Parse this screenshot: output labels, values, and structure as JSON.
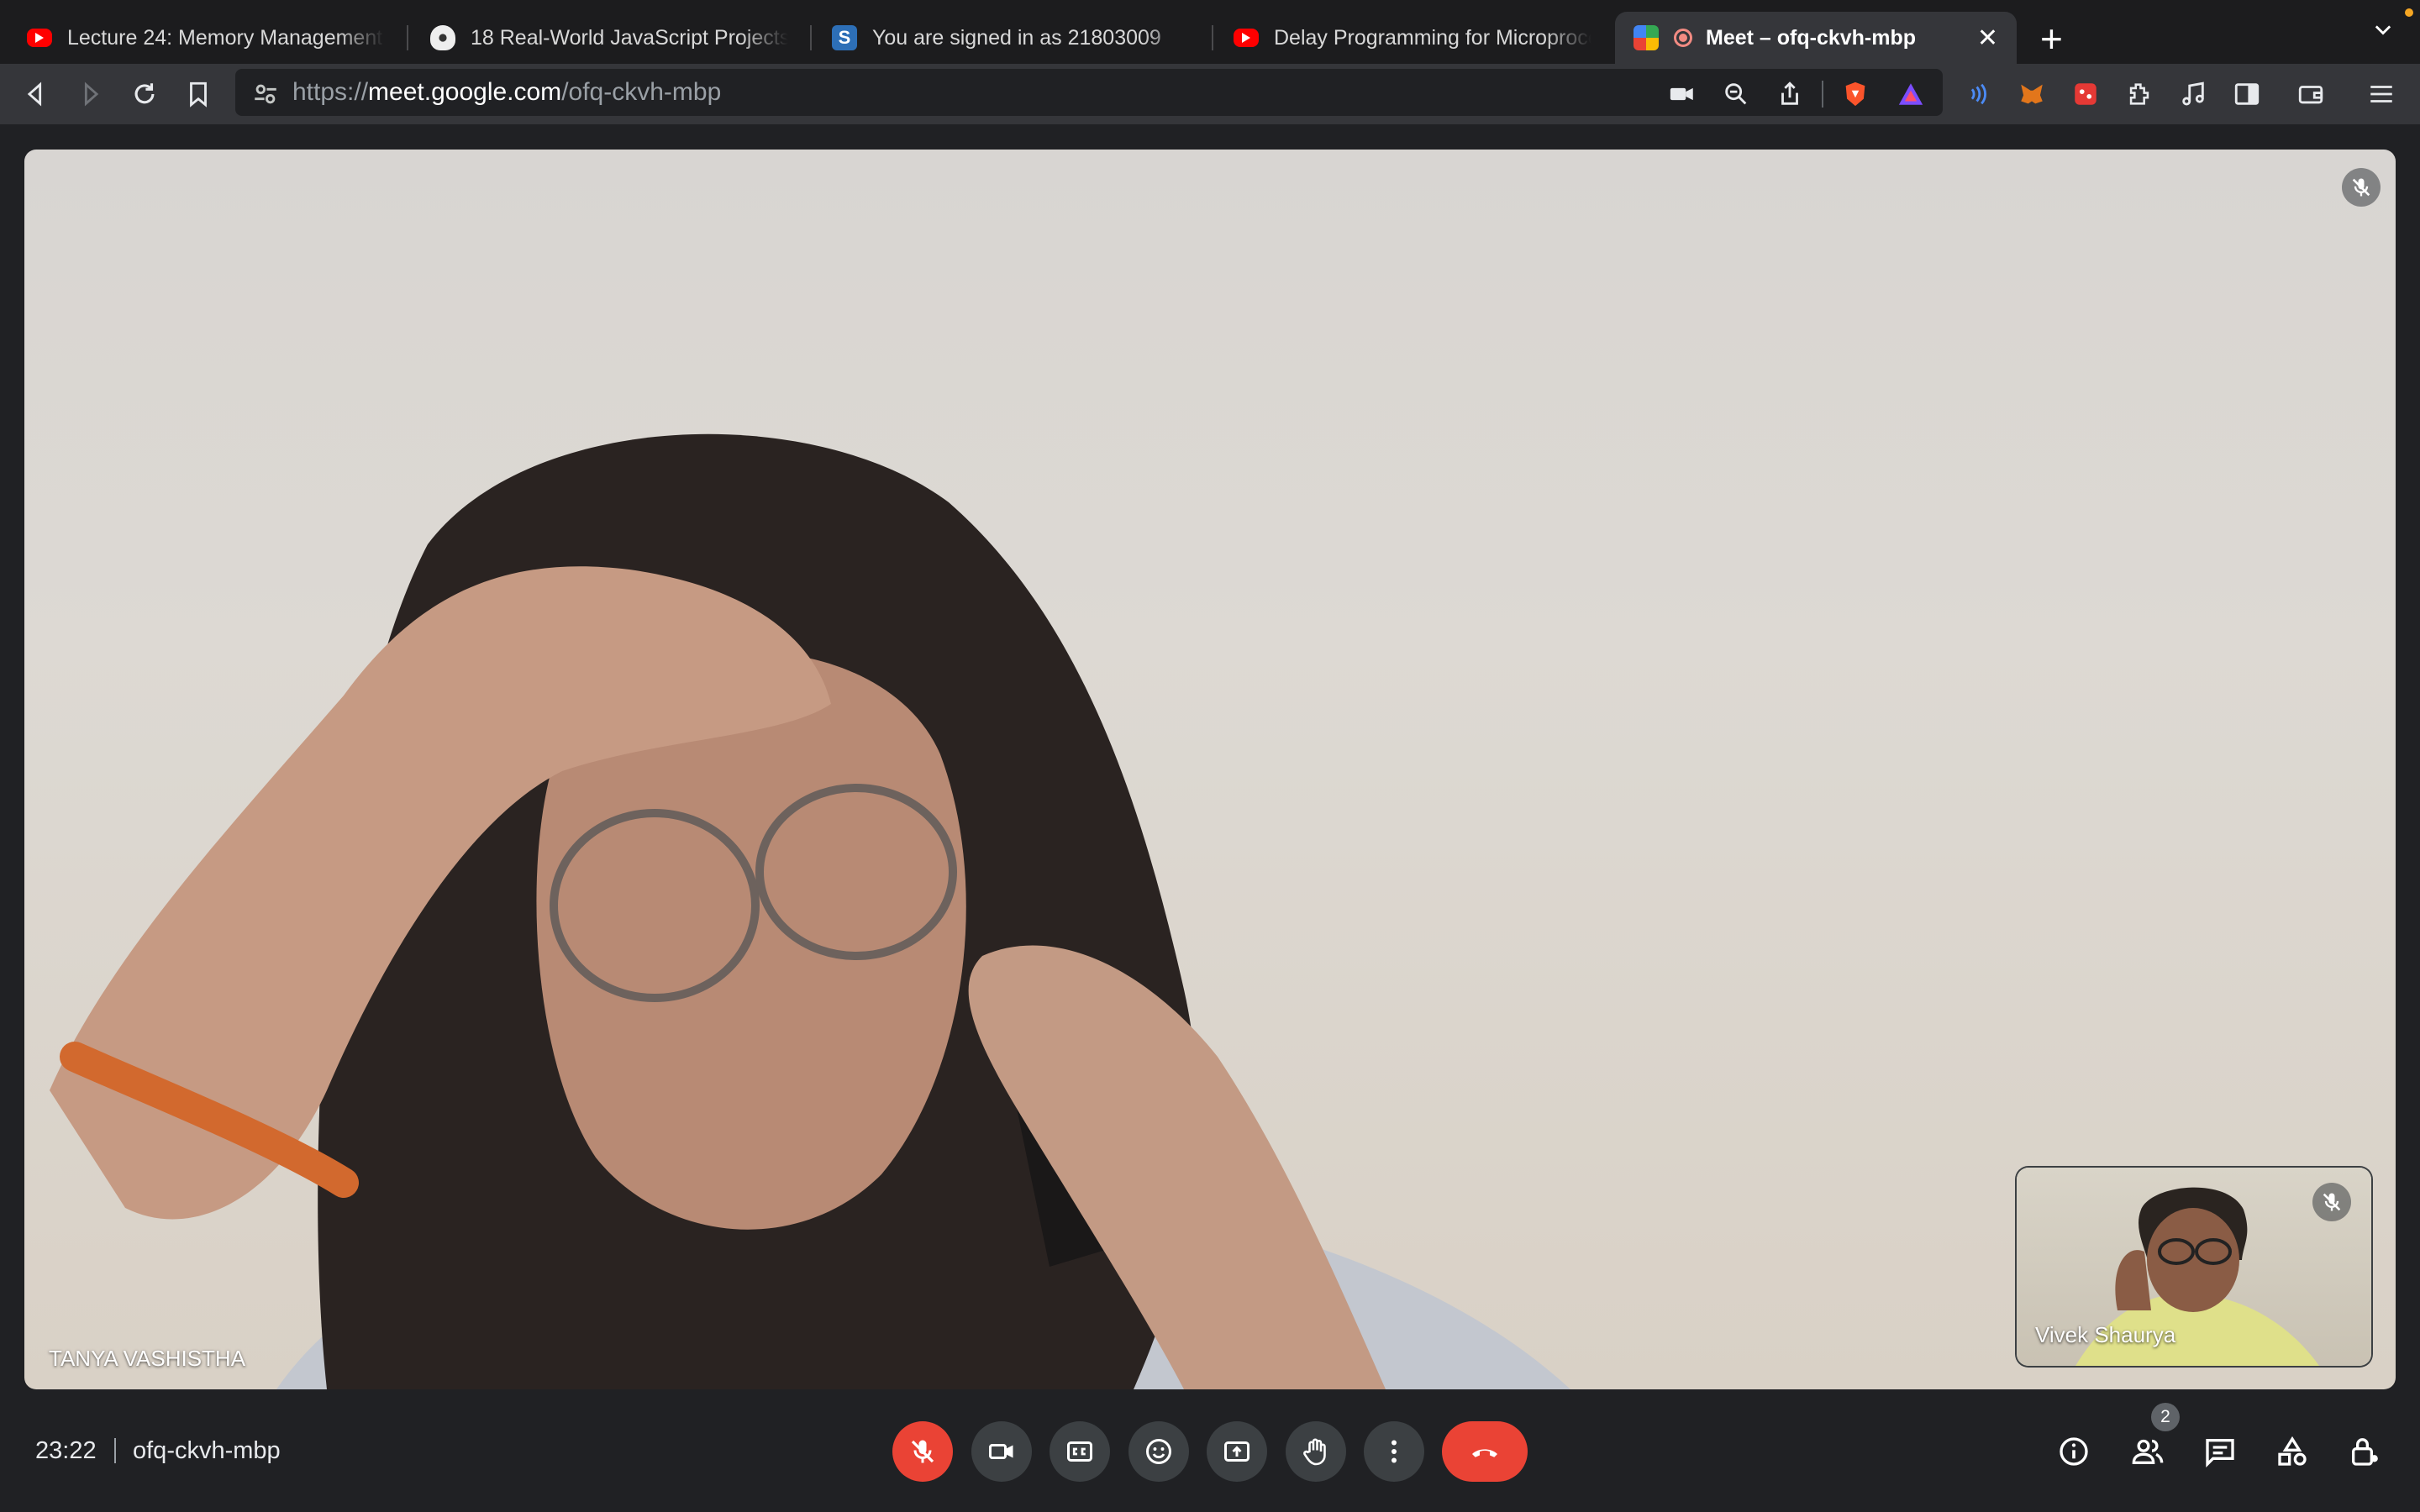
{
  "browser": {
    "tabs": [
      {
        "title": "Lecture 24: Memory Management i",
        "favicon": "youtube-icon",
        "active": false
      },
      {
        "title": "18 Real-World JavaScript Projects",
        "favicon": "shield-site-icon",
        "active": false
      },
      {
        "title": "You are signed in as 21803009",
        "favicon": "s-site-icon",
        "active": false
      },
      {
        "title": "Delay Programming for Microproce",
        "favicon": "youtube-icon",
        "active": false
      },
      {
        "title": "Meet – ofq-ckvh-mbp",
        "favicon": "google-meet-icon",
        "active": true,
        "recording_indicator": true
      }
    ],
    "new_tab_label": "+",
    "url_scheme": "https://",
    "url_host": "meet.google.com",
    "url_path": "/ofq-ckvh-mbp"
  },
  "meeting": {
    "main_participant_name": "TANYA VASHISTHA",
    "self_participant_name": "Vivek Shaurya",
    "time": "23:22",
    "meeting_code": "ofq-ckvh-mbp",
    "participant_count": "2",
    "mic_muted": true
  },
  "colors": {
    "end_call": "#ea4335",
    "control_bg": "#3c4043",
    "background": "#202124",
    "active_tab": "#35363a"
  }
}
